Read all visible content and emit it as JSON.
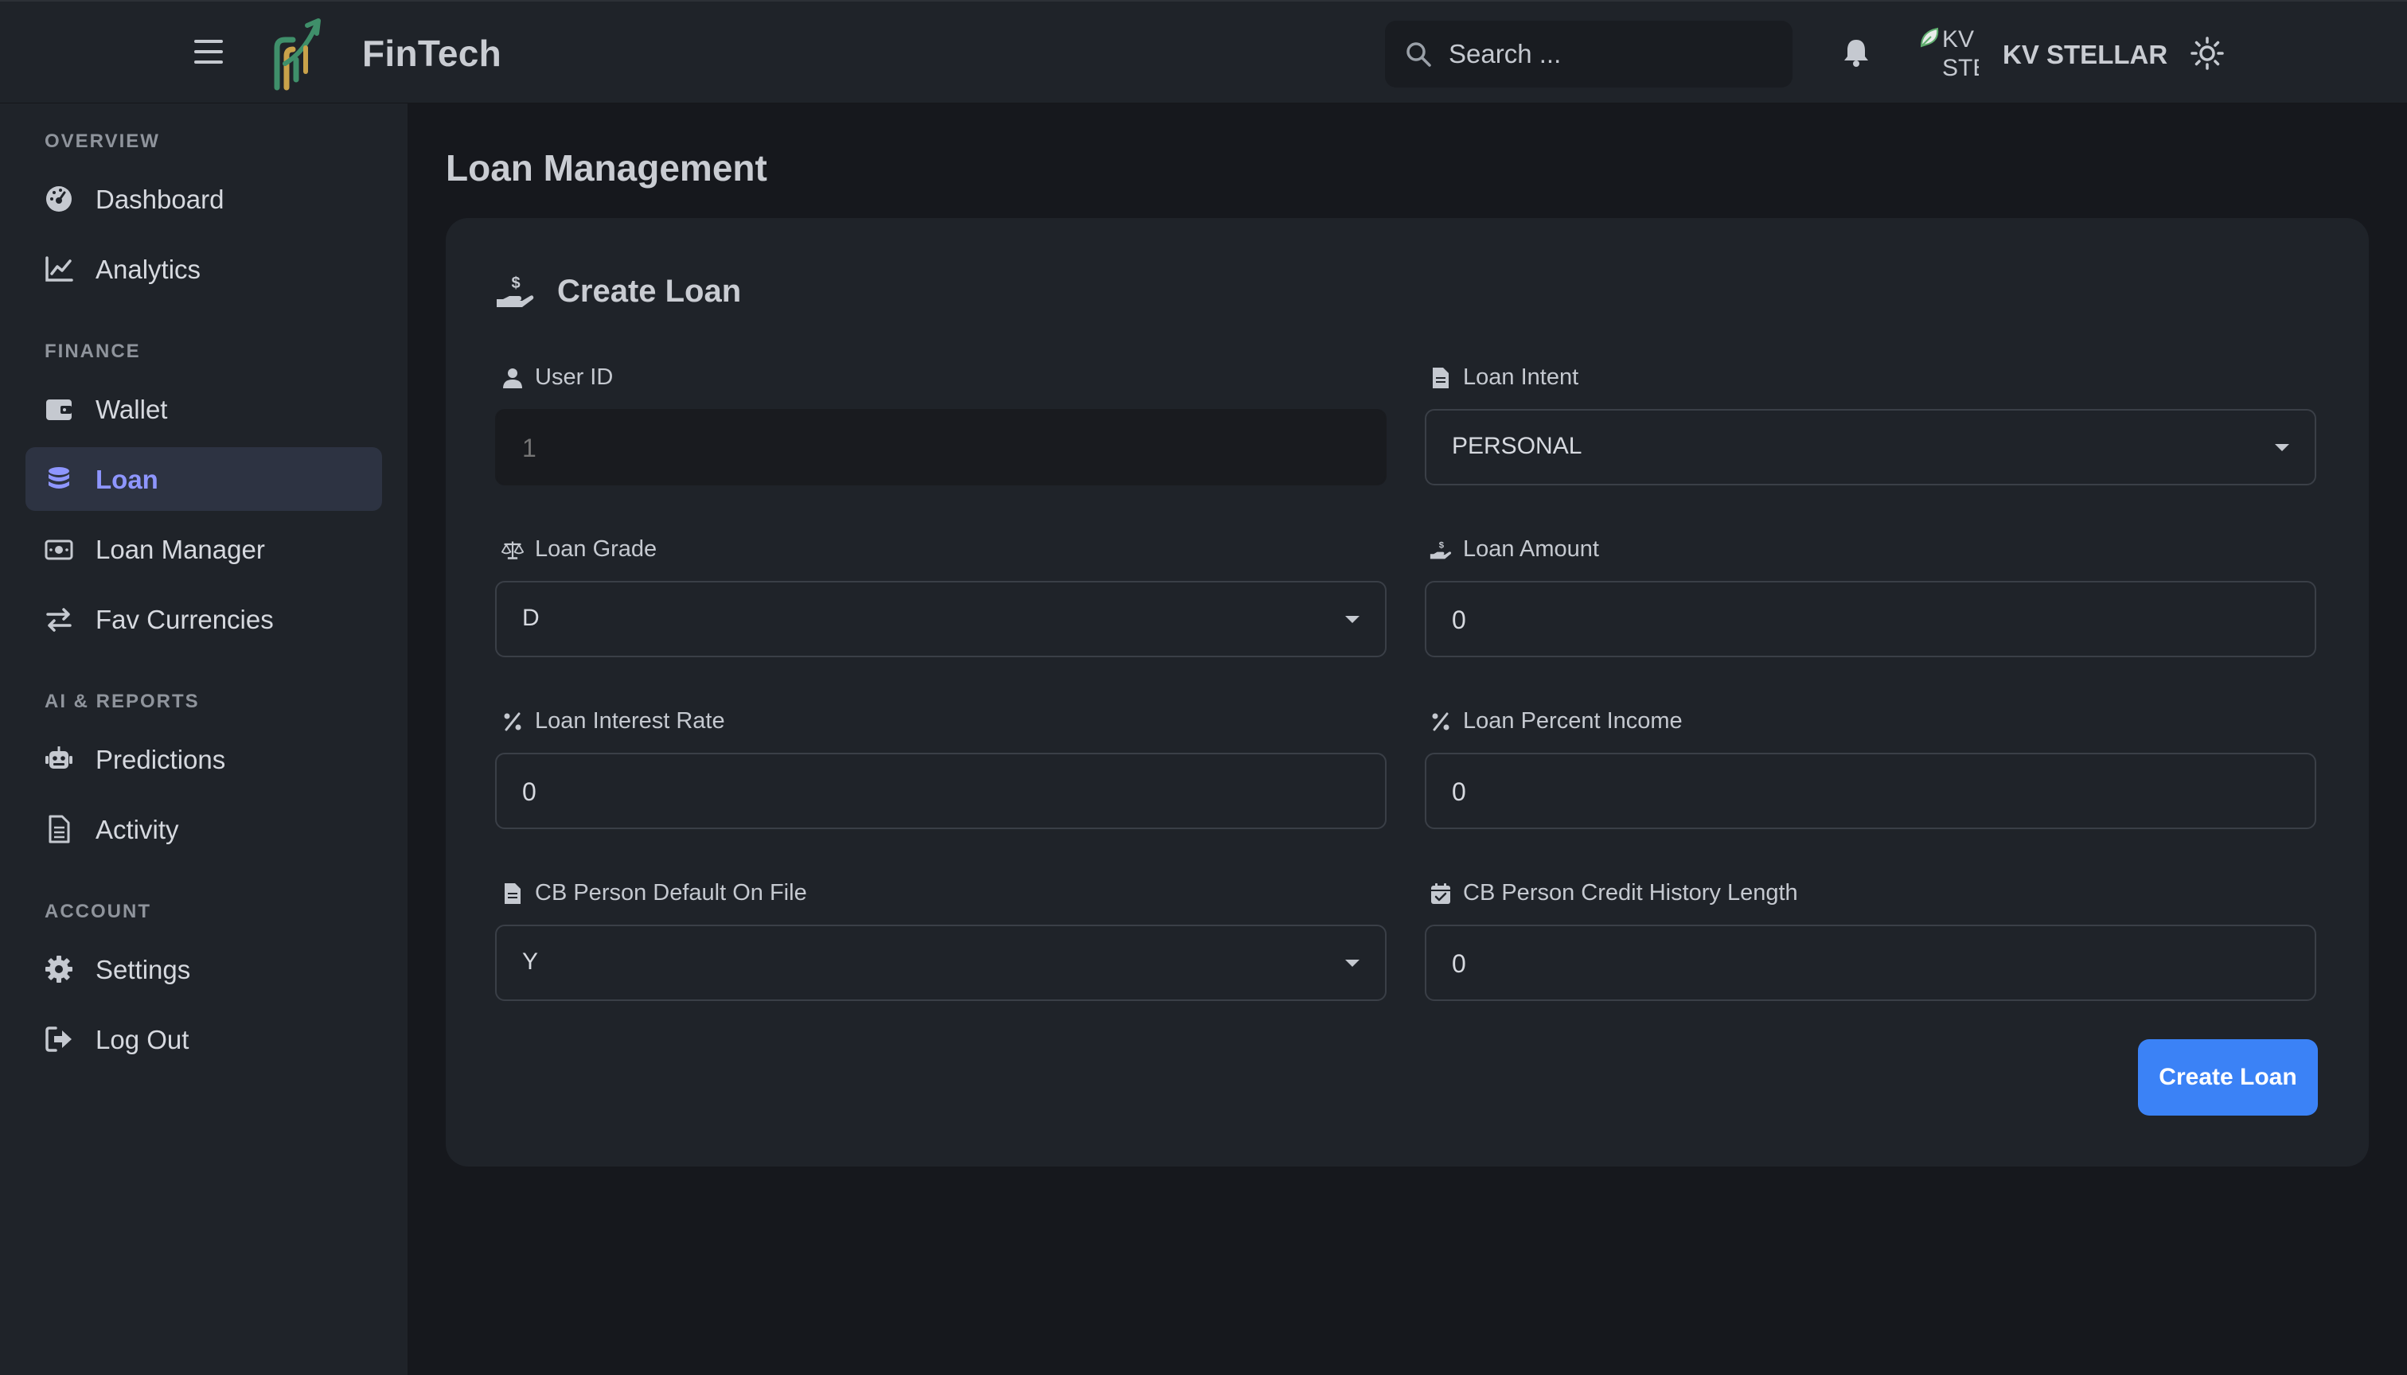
{
  "header": {
    "brand": "FinTech",
    "search_placeholder": "Search ...",
    "avatar_alt": "KV STELLAR",
    "username": "KV STELLAR"
  },
  "sidebar": {
    "sections": [
      {
        "label": "OVERVIEW"
      },
      {
        "label": "FINANCE"
      },
      {
        "label": "AI & REPORTS"
      },
      {
        "label": "ACCOUNT"
      }
    ],
    "items": [
      {
        "label": "Dashboard",
        "icon": "gauge-icon",
        "active": false
      },
      {
        "label": "Analytics",
        "icon": "chart-line-icon",
        "active": false
      },
      {
        "label": "Wallet",
        "icon": "wallet-icon",
        "active": false
      },
      {
        "label": "Loan",
        "icon": "coins-icon",
        "active": true
      },
      {
        "label": "Loan Manager",
        "icon": "money-bill-icon",
        "active": false
      },
      {
        "label": "Fav Currencies",
        "icon": "exchange-icon",
        "active": false
      },
      {
        "label": "Predictions",
        "icon": "robot-icon",
        "active": false
      },
      {
        "label": "Activity",
        "icon": "file-lines-icon",
        "active": false
      },
      {
        "label": "Settings",
        "icon": "gear-icon",
        "active": false
      },
      {
        "label": "Log Out",
        "icon": "logout-icon",
        "active": false
      }
    ]
  },
  "main": {
    "page_title": "Loan Management",
    "card_title": "Create Loan",
    "fields": {
      "user_id": {
        "label": "User ID",
        "value": "1",
        "icon": "user-icon"
      },
      "loan_intent": {
        "label": "Loan Intent",
        "value": "PERSONAL",
        "icon": "file-icon"
      },
      "loan_grade": {
        "label": "Loan Grade",
        "value": "D",
        "icon": "scale-icon"
      },
      "loan_amount": {
        "label": "Loan Amount",
        "value": "0",
        "icon": "hand-dollar-icon"
      },
      "interest_rate": {
        "label": "Loan Interest Rate",
        "value": "0",
        "icon": "percent-icon"
      },
      "percent_income": {
        "label": "Loan Percent Income",
        "value": "0",
        "icon": "percent-icon"
      },
      "default_on_file": {
        "label": "CB Person Default On File",
        "value": "Y",
        "icon": "file-icon"
      },
      "credit_history": {
        "label": "CB Person Credit History Length",
        "value": "0",
        "icon": "calendar-check-icon"
      }
    },
    "submit_label": "Create Loan"
  },
  "colors": {
    "accent": "#3b82f6",
    "active_nav": "#8e96ff",
    "background": "#16181d",
    "panel": "#1f2329"
  }
}
